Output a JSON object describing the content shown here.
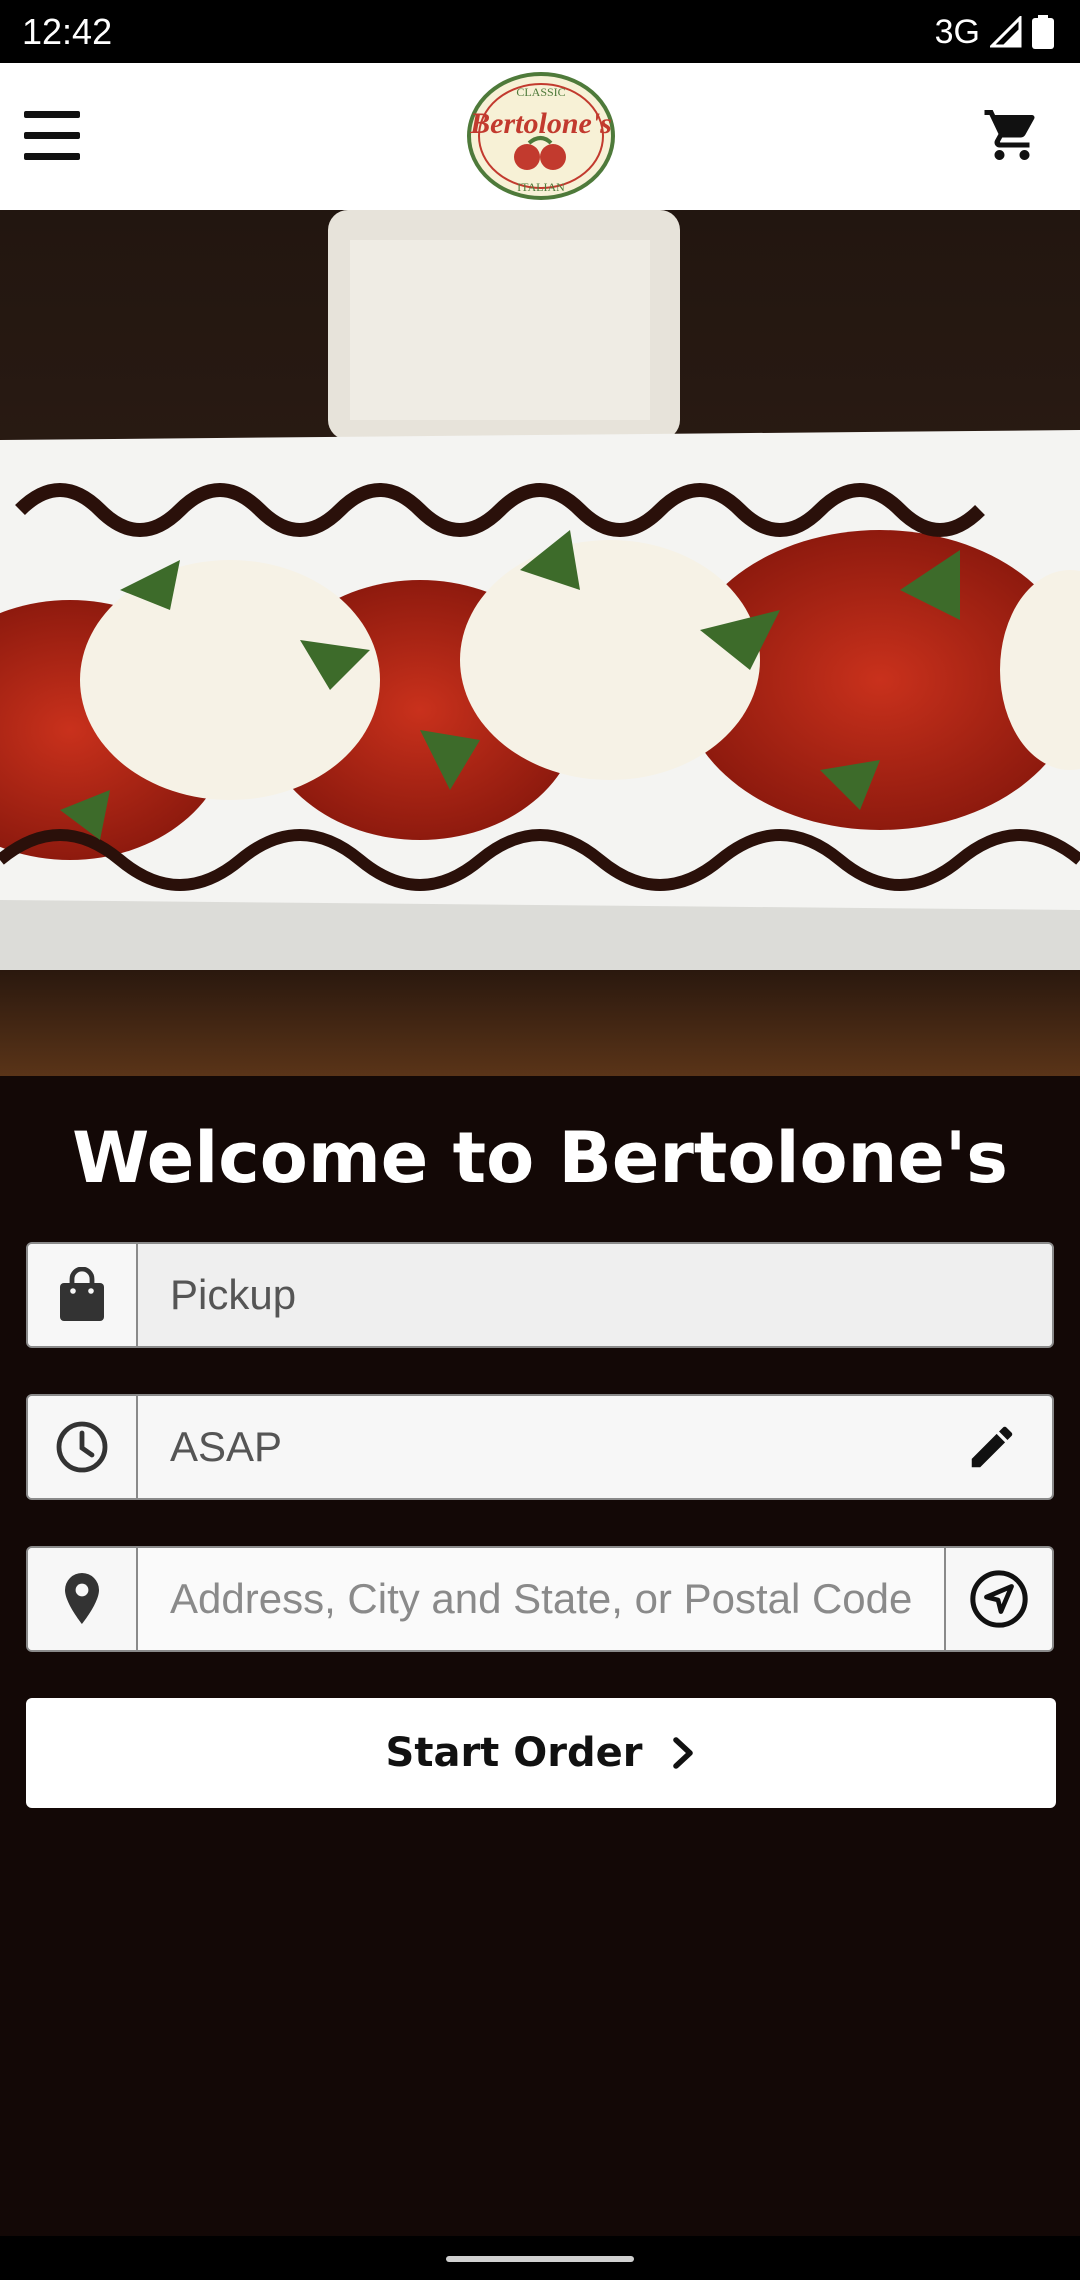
{
  "status_bar": {
    "time": "12:42",
    "network": "3G"
  },
  "app_bar": {
    "logo_top_text": "CLASSIC",
    "logo_name": "Bertolone's",
    "logo_bottom_text": "ITALIAN"
  },
  "main": {
    "welcome_title": "Welcome to Bertolone's",
    "order_type": "Pickup",
    "order_time": "ASAP",
    "address_placeholder": "Address, City and State, or Postal Code",
    "start_order_label": "Start Order"
  },
  "icons": {
    "menu": "menu-icon",
    "cart": "cart-icon",
    "order_type": "shopping-bag-icon",
    "time": "clock-icon",
    "edit": "pencil-icon",
    "location": "map-pin-icon",
    "locate": "navigation-arrow-icon",
    "next": "chevron-right-icon"
  },
  "colors": {
    "background": "#130806",
    "app_bar": "#ffffff",
    "logo_red": "#c23a2e",
    "logo_green": "#4e7a3a",
    "button": "#ffffff"
  }
}
